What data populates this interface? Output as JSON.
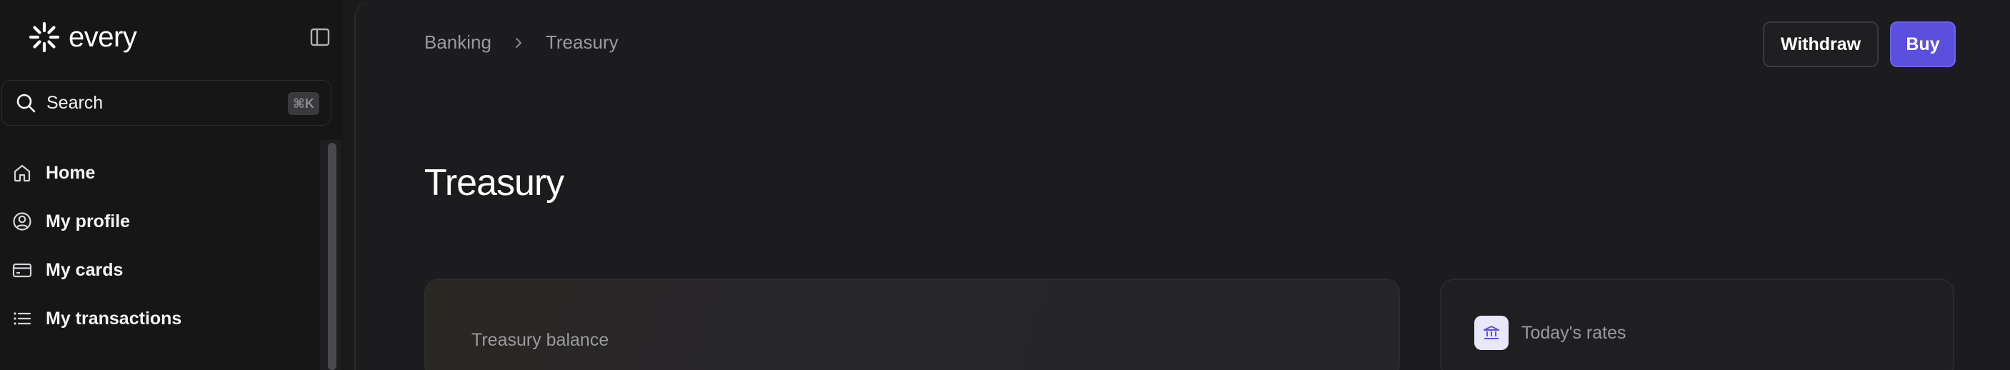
{
  "brand": {
    "name": "every"
  },
  "search": {
    "label": "Search",
    "shortcut": "⌘K"
  },
  "sidebar": {
    "items": [
      {
        "label": "Home",
        "icon": "home-icon"
      },
      {
        "label": "My profile",
        "icon": "profile-icon"
      },
      {
        "label": "My cards",
        "icon": "card-icon"
      },
      {
        "label": "My transactions",
        "icon": "list-icon"
      }
    ]
  },
  "breadcrumb": {
    "items": [
      "Banking",
      "Treasury"
    ]
  },
  "actions": {
    "withdraw_label": "Withdraw",
    "buy_label": "Buy"
  },
  "page": {
    "title": "Treasury"
  },
  "cards": {
    "balance": {
      "label": "Treasury balance"
    },
    "rates": {
      "label": "Today's rates",
      "icon": "bank-icon"
    }
  },
  "colors": {
    "accent": "#5b4fde",
    "background": "#1c1c1e",
    "sidebar": "#161617",
    "muted_text": "#9a9a9e"
  }
}
